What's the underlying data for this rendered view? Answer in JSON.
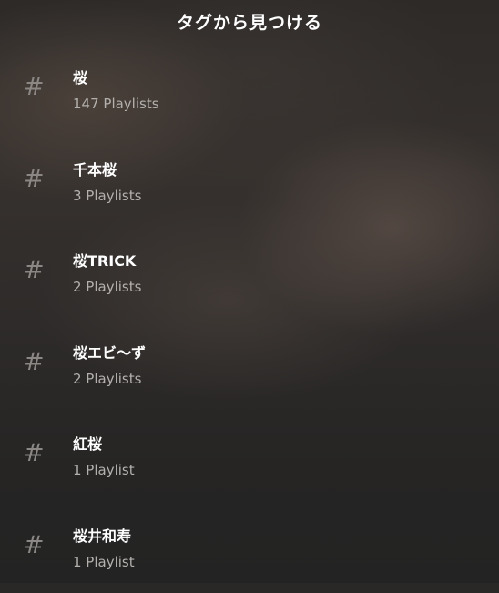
{
  "header": {
    "title": "タグから見つける"
  },
  "tags": [
    {
      "icon": "hash-icon",
      "hash": "#",
      "name": "桜",
      "count": "147 Playlists"
    },
    {
      "icon": "hash-icon",
      "hash": "#",
      "name": "千本桜",
      "count": "3 Playlists"
    },
    {
      "icon": "hash-icon",
      "hash": "#",
      "name": "桜TRICK",
      "count": "2 Playlists"
    },
    {
      "icon": "hash-icon",
      "hash": "#",
      "name": "桜エビ〜ず",
      "count": "2 Playlists"
    },
    {
      "icon": "hash-icon",
      "hash": "#",
      "name": "紅桜",
      "count": "1 Playlist"
    },
    {
      "icon": "hash-icon",
      "hash": "#",
      "name": "桜井和寿",
      "count": "1 Playlist"
    }
  ]
}
